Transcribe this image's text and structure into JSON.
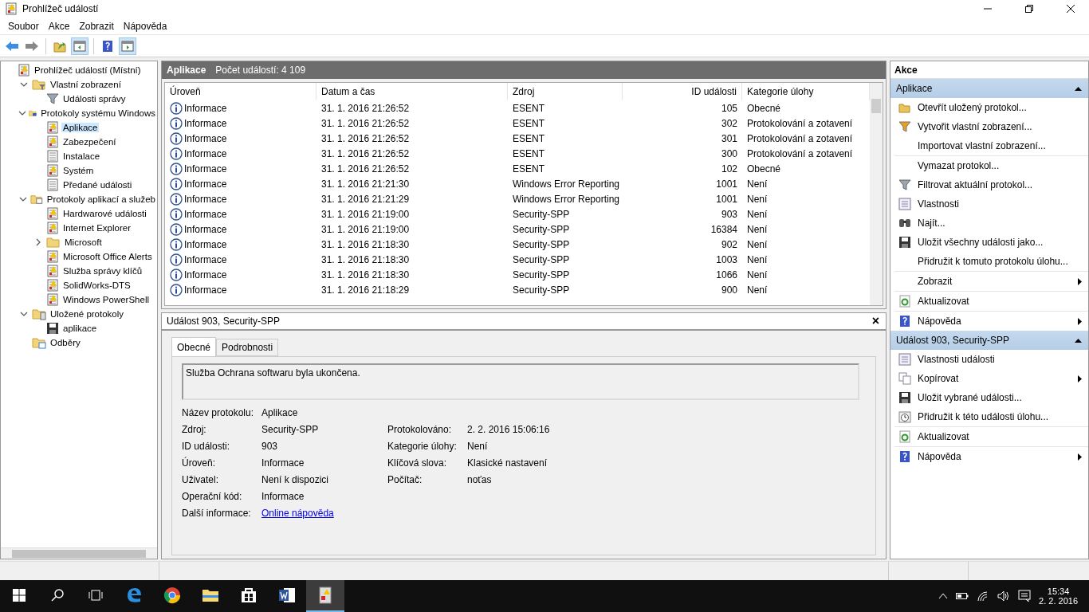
{
  "window": {
    "title": "Prohlížeč událostí"
  },
  "menu": [
    "Soubor",
    "Akce",
    "Zobrazit",
    "Nápověda"
  ],
  "toolbar": [
    {
      "kind": "back"
    },
    {
      "kind": "forward"
    },
    {
      "kind": "sep"
    },
    {
      "kind": "folder-up"
    },
    {
      "kind": "pane-left",
      "selected": true
    },
    {
      "kind": "sep"
    },
    {
      "kind": "help"
    },
    {
      "kind": "pane-right",
      "selected": true
    }
  ],
  "tree": [
    {
      "label": "Prohlížeč událostí (Místní)",
      "kind": "root",
      "selected": false,
      "children": [
        {
          "label": "Vlastní zobrazení",
          "kind": "folder-filter",
          "expanded": true,
          "selected": false,
          "children": [
            {
              "label": "Události správy",
              "kind": "filter",
              "selected": false
            }
          ]
        },
        {
          "label": "Protokoly systému Windows",
          "kind": "folder-pc",
          "expanded": true,
          "selected": false,
          "children": [
            {
              "label": "Aplikace",
              "kind": "log-warn",
              "selected": true
            },
            {
              "label": "Zabezpečení",
              "kind": "log-warn",
              "selected": false
            },
            {
              "label": "Instalace",
              "kind": "log",
              "selected": false
            },
            {
              "label": "Systém",
              "kind": "log-warn",
              "selected": false
            },
            {
              "label": "Předané události",
              "kind": "log",
              "selected": false
            }
          ]
        },
        {
          "label": "Protokoly aplikací a služeb",
          "kind": "folder-win",
          "expanded": true,
          "selected": false,
          "children": [
            {
              "label": "Hardwarové události",
              "kind": "log-warn",
              "selected": false
            },
            {
              "label": "Internet Explorer",
              "kind": "log-warn",
              "selected": false
            },
            {
              "label": "Microsoft",
              "kind": "folder",
              "expanded": false,
              "selected": false
            },
            {
              "label": "Microsoft Office Alerts",
              "kind": "log-warn",
              "selected": false
            },
            {
              "label": "Služba správy klíčů",
              "kind": "log-warn",
              "selected": false
            },
            {
              "label": "SolidWorks-DTS",
              "kind": "log-warn",
              "selected": false
            },
            {
              "label": "Windows PowerShell",
              "kind": "log-warn",
              "selected": false
            }
          ]
        },
        {
          "label": "Uložené protokoly",
          "kind": "folder-log",
          "expanded": true,
          "selected": false,
          "children": [
            {
              "label": "aplikace",
              "kind": "disk",
              "selected": false
            }
          ]
        },
        {
          "label": "Odběry",
          "kind": "folder-sub",
          "selected": false
        }
      ]
    }
  ],
  "list_header": {
    "title": "Aplikace",
    "count": "Počet událostí: 4 109"
  },
  "table": {
    "columns": [
      "Úroveň",
      "Datum a čas",
      "Zdroj",
      "ID události",
      "Kategorie úlohy"
    ],
    "rows": [
      [
        "Informace",
        "31. 1. 2016 21:26:52",
        "ESENT",
        "105",
        "Obecné"
      ],
      [
        "Informace",
        "31. 1. 2016 21:26:52",
        "ESENT",
        "302",
        "Protokolování a zotavení"
      ],
      [
        "Informace",
        "31. 1. 2016 21:26:52",
        "ESENT",
        "301",
        "Protokolování a zotavení"
      ],
      [
        "Informace",
        "31. 1. 2016 21:26:52",
        "ESENT",
        "300",
        "Protokolování a zotavení"
      ],
      [
        "Informace",
        "31. 1. 2016 21:26:52",
        "ESENT",
        "102",
        "Obecné"
      ],
      [
        "Informace",
        "31. 1. 2016 21:21:30",
        "Windows Error Reporting",
        "1001",
        "Není"
      ],
      [
        "Informace",
        "31. 1. 2016 21:21:29",
        "Windows Error Reporting",
        "1001",
        "Není"
      ],
      [
        "Informace",
        "31. 1. 2016 21:19:00",
        "Security-SPP",
        "903",
        "Není"
      ],
      [
        "Informace",
        "31. 1. 2016 21:19:00",
        "Security-SPP",
        "16384",
        "Není"
      ],
      [
        "Informace",
        "31. 1. 2016 21:18:30",
        "Security-SPP",
        "902",
        "Není"
      ],
      [
        "Informace",
        "31. 1. 2016 21:18:30",
        "Security-SPP",
        "1003",
        "Není"
      ],
      [
        "Informace",
        "31. 1. 2016 21:18:30",
        "Security-SPP",
        "1066",
        "Není"
      ],
      [
        "Informace",
        "31. 1. 2016 21:18:29",
        "Security-SPP",
        "900",
        "Není"
      ]
    ]
  },
  "detail": {
    "title": "Událost 903, Security-SPP",
    "close": "×",
    "tabs": [
      {
        "label": "Obecné",
        "selected": true
      },
      {
        "label": "Podrobnosti",
        "selected": false
      }
    ],
    "message": "Služba Ochrana softwaru byla ukončena.",
    "fields_left": [
      {
        "label": "Název protokolu:",
        "value": "Aplikace"
      },
      {
        "label": "Zdroj:",
        "value": "Security-SPP"
      },
      {
        "label": "ID události:",
        "value": "903"
      },
      {
        "label": "Úroveň:",
        "value": "Informace"
      },
      {
        "label": "Uživatel:",
        "value": "Není k dispozici"
      },
      {
        "label": "Operační kód:",
        "value": "Informace"
      },
      {
        "label": "Další informace:",
        "value": "Online nápověda",
        "kind": "link"
      }
    ],
    "fields_right": [
      {
        "label": "Protokolováno:",
        "value": "2. 2. 2016 15:06:16"
      },
      {
        "label": "Kategorie úlohy:",
        "value": "Není"
      },
      {
        "label": "Klíčová slova:",
        "value": "Klasické nastavení"
      },
      {
        "label": "Počítač:",
        "value": "noťas"
      }
    ]
  },
  "actions": {
    "title": "Akce",
    "sections": [
      {
        "title": "Aplikace",
        "items": [
          {
            "label": "Otevřít uložený protokol...",
            "kind": "open"
          },
          {
            "label": "Vytvořit vlastní zobrazení...",
            "kind": "filter-new"
          },
          {
            "label": "Importovat vlastní zobrazení...",
            "kind": "none"
          },
          {
            "label": "Vymazat protokol...",
            "kind": "none",
            "separator": true
          },
          {
            "label": "Filtrovat aktuální protokol...",
            "kind": "filter"
          },
          {
            "label": "Vlastnosti",
            "kind": "props"
          },
          {
            "label": "Najít...",
            "kind": "find"
          },
          {
            "label": "Uložit všechny události jako...",
            "kind": "save"
          },
          {
            "label": "Přidružit k tomuto protokolu úlohu...",
            "kind": "none"
          },
          {
            "label": "Zobrazit",
            "kind": "none",
            "separator": true,
            "submenu": true
          },
          {
            "label": "Aktualizovat",
            "kind": "refresh",
            "separator": true
          },
          {
            "label": "Nápověda",
            "kind": "help",
            "separator": true,
            "submenu": true
          }
        ]
      },
      {
        "title": "Událost 903, Security-SPP",
        "items": [
          {
            "label": "Vlastnosti události",
            "kind": "props"
          },
          {
            "label": "Kopírovat",
            "kind": "copy",
            "submenu": true
          },
          {
            "label": "Uložit vybrané události...",
            "kind": "save"
          },
          {
            "label": "Přidružit k této události úlohu...",
            "kind": "task"
          },
          {
            "label": "Aktualizovat",
            "kind": "refresh",
            "separator": true
          },
          {
            "label": "Nápověda",
            "kind": "help",
            "separator": true,
            "submenu": true
          }
        ]
      }
    ]
  },
  "taskbar": {
    "apps": [
      {
        "kind": "edge",
        "selected": false
      },
      {
        "kind": "chrome",
        "selected": false
      },
      {
        "kind": "explorer",
        "selected": false
      },
      {
        "kind": "store",
        "selected": false
      },
      {
        "kind": "word",
        "selected": false
      },
      {
        "kind": "eventvwr",
        "selected": true
      }
    ],
    "time": "15:34",
    "date": "2. 2. 2016"
  }
}
